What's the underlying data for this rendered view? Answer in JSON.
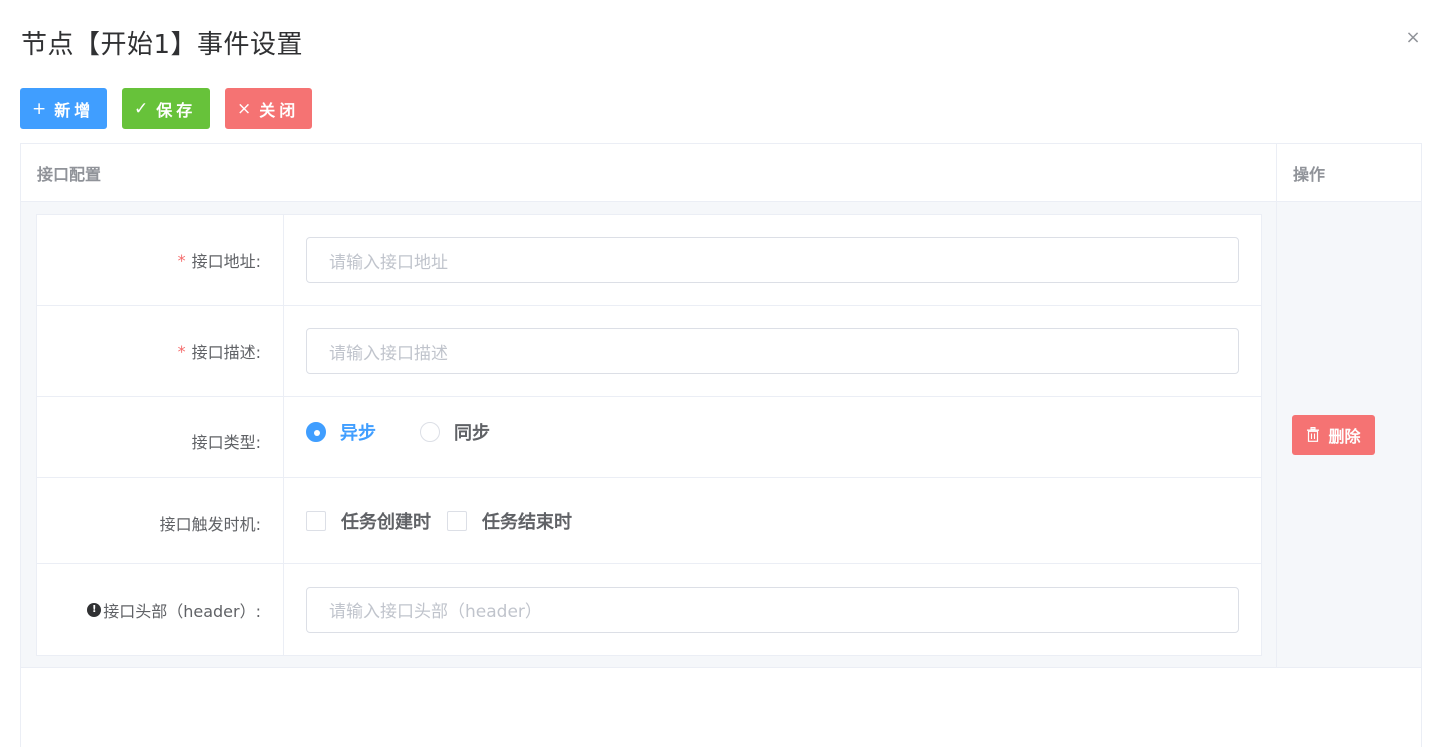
{
  "dialog": {
    "title": "节点【开始1】事件设置",
    "close_glyph": "×"
  },
  "toolbar": {
    "add_label": "新增",
    "save_label": "保存",
    "close_label": "关闭",
    "add_icon": "plus-icon",
    "save_icon": "check-icon",
    "close_icon": "close-icon"
  },
  "table": {
    "col_config": "接口配置",
    "col_op": "操作"
  },
  "form": {
    "url": {
      "required": "*",
      "label": "接口地址:",
      "placeholder": "请输入接口地址"
    },
    "desc": {
      "required": "*",
      "label": "接口描述:",
      "placeholder": "请输入接口描述"
    },
    "type": {
      "label": "接口类型:",
      "options": [
        "异步",
        "同步"
      ],
      "selected": "异步"
    },
    "trigger": {
      "label": "接口触发时机:",
      "options": [
        "任务创建时",
        "任务结束时"
      ],
      "checked": []
    },
    "header": {
      "label": "接口头部（header）:",
      "placeholder": "请输入接口头部（header）",
      "info_glyph": "!"
    }
  },
  "row_actions": {
    "delete_label": "删除",
    "delete_icon": "trash-icon"
  },
  "colors": {
    "primary": "#409eff",
    "success": "#67c23a",
    "danger": "#f56c6c"
  }
}
